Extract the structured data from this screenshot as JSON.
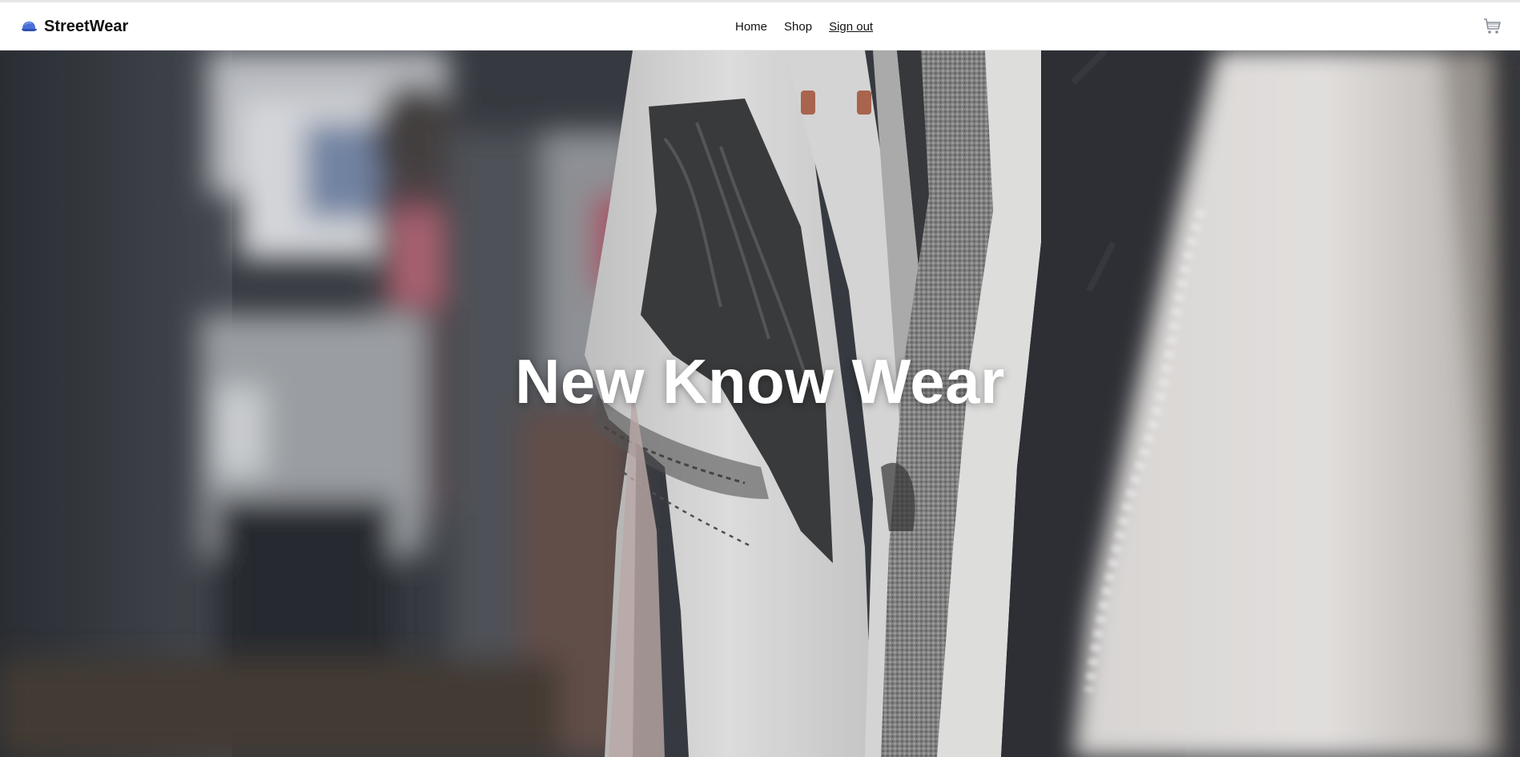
{
  "brand": {
    "name": "StreetWear",
    "icon": "cap-icon",
    "icon_color": "#4a6fd8"
  },
  "nav": {
    "items": [
      {
        "label": "Home"
      },
      {
        "label": "Shop"
      },
      {
        "label": "Sign out"
      }
    ]
  },
  "cart": {
    "icon": "cart-icon"
  },
  "hero": {
    "title": "New Know Wear",
    "background": "photo of clothes hanging on a rack"
  },
  "colors": {
    "text": "#111111",
    "hero_text": "#ffffff",
    "navbar_bg": "#ffffff"
  }
}
